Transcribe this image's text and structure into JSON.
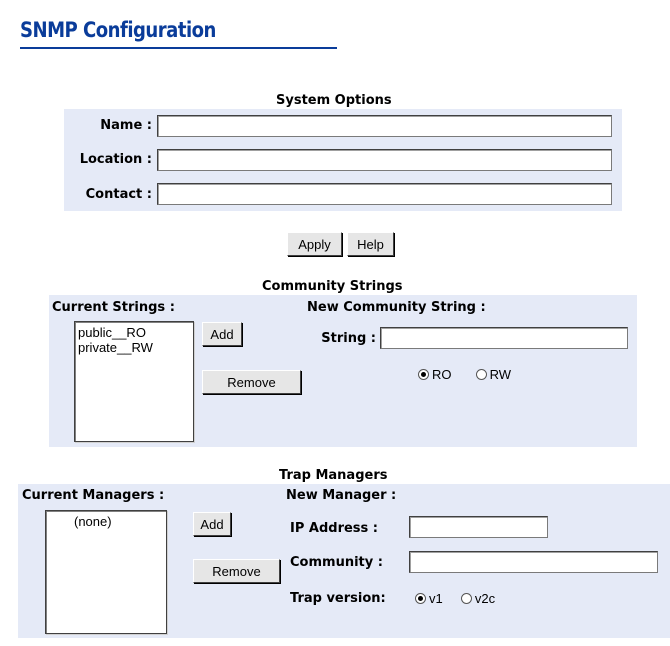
{
  "page": {
    "title": "SNMP Configuration"
  },
  "system_options": {
    "heading": "System Options",
    "name_label": "Name :",
    "location_label": "Location :",
    "contact_label": "Contact :",
    "name_value": "",
    "location_value": "",
    "contact_value": ""
  },
  "actions": {
    "apply_label": "Apply",
    "help_label": "Help"
  },
  "community_strings": {
    "heading": "Community Strings",
    "current_label": "Current Strings :",
    "items": [
      "public__RO",
      "private__RW"
    ],
    "add_label": "Add",
    "remove_label": "Remove",
    "new_label": "New Community String :",
    "string_label": "String :",
    "string_value": "",
    "access_options": [
      "RO",
      "RW"
    ],
    "access_selected": "RO"
  },
  "trap_managers": {
    "heading": "Trap Managers",
    "current_label": "Current Managers :",
    "items": [
      "(none)"
    ],
    "add_label": "Add",
    "remove_label": "Remove",
    "new_label": "New Manager :",
    "ip_label": "IP Address :",
    "ip_value": "",
    "community_label": "Community :",
    "community_value": "",
    "version_label": "Trap version:",
    "version_options": [
      "v1",
      "v2c"
    ],
    "version_selected": "v1"
  }
}
